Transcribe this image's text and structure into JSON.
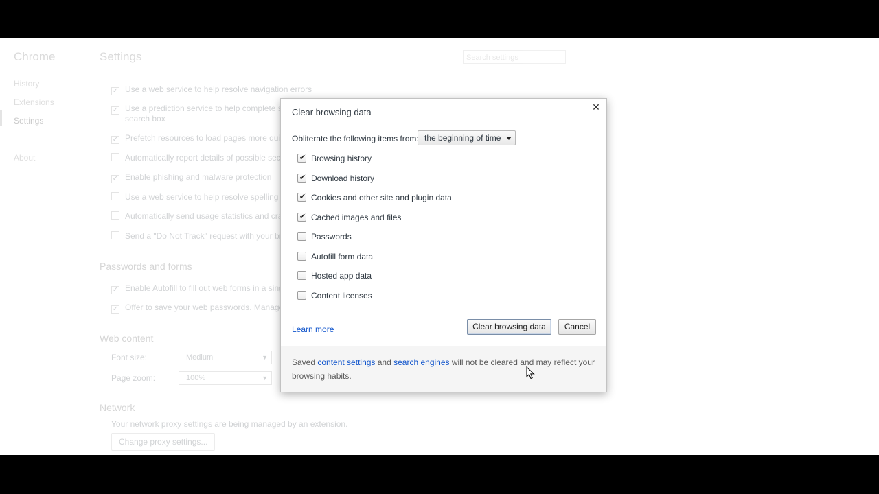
{
  "settings_page": {
    "brand": "Chrome",
    "nav": [
      "History",
      "Extensions",
      "Settings",
      "About"
    ],
    "heading": "Settings",
    "search_placeholder": "Search settings",
    "privacy_options": [
      {
        "label": "Use a web service to help resolve navigation errors",
        "checked": true
      },
      {
        "label": "Use a prediction service to help complete se",
        "label2": "search box",
        "checked": true
      },
      {
        "label": "Prefetch resources to load pages more quick",
        "checked": true
      },
      {
        "label": "Automatically report details of possible secu",
        "checked": false
      },
      {
        "label": "Enable phishing and malware protection",
        "checked": true
      },
      {
        "label": "Use a web service to help resolve spelling err",
        "checked": false
      },
      {
        "label": "Automatically send usage statistics and crash",
        "checked": false
      },
      {
        "label": "Send a \"Do Not Track\" request with your bro",
        "checked": false
      }
    ],
    "passwords_heading": "Passwords and forms",
    "password_options": [
      {
        "label": "Enable Autofill to fill out web forms in a sing",
        "checked": true
      },
      {
        "label": "Offer to save your web passwords. Manage p",
        "checked": true
      }
    ],
    "web_content_heading": "Web content",
    "font_size_label": "Font size:",
    "font_size_value": "Medium",
    "page_zoom_label": "Page zoom:",
    "page_zoom_value": "100%",
    "network_heading": "Network",
    "network_desc": "Your network proxy settings are being managed by an extension.",
    "proxy_button": "Change proxy settings..."
  },
  "dialog": {
    "title": "Clear browsing data",
    "close_glyph": "✕",
    "time_label": "Obliterate the following items from:",
    "time_value": "the beginning of time",
    "items": [
      {
        "label": "Browsing history",
        "checked": true
      },
      {
        "label": "Download history",
        "checked": true
      },
      {
        "label": "Cookies and other site and plugin data",
        "checked": true
      },
      {
        "label": "Cached images and files",
        "checked": true
      },
      {
        "label": "Passwords",
        "checked": false
      },
      {
        "label": "Autofill form data",
        "checked": false
      },
      {
        "label": "Hosted app data",
        "checked": false
      },
      {
        "label": "Content licenses",
        "checked": false
      }
    ],
    "learn_more": "Learn more",
    "clear_button": "Clear browsing data",
    "cancel_button": "Cancel",
    "footer": {
      "t1": "Saved ",
      "link1": "content settings",
      "t2": " and ",
      "link2": "search engines",
      "t3": " will not be cleared and may reflect your browsing habits."
    }
  }
}
